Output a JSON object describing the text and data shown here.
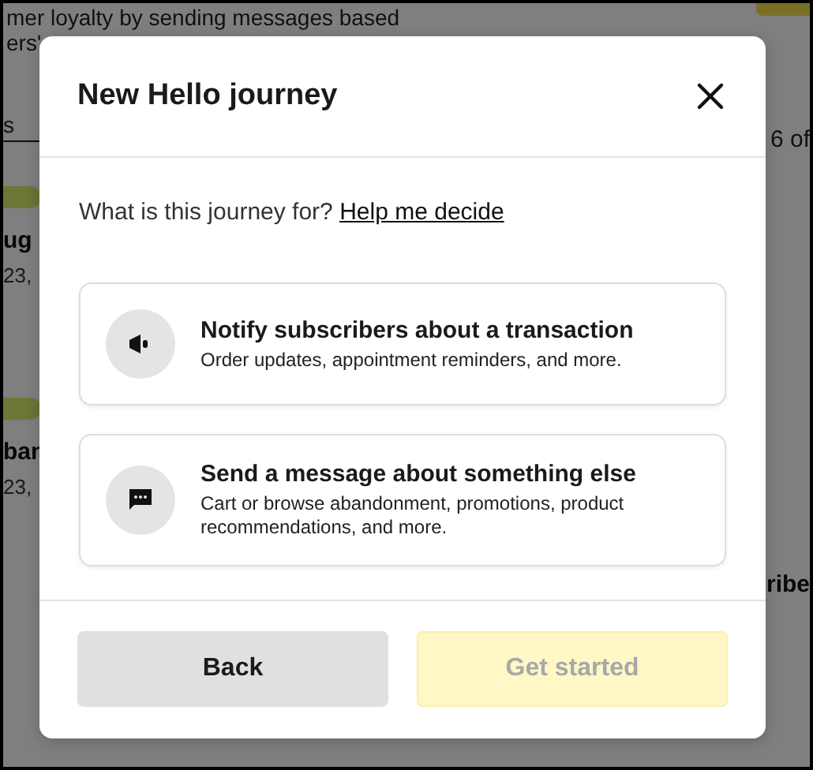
{
  "background": {
    "intro_lines": [
      "mer loyalty by sending messages based",
      "ers'"
    ],
    "left": {
      "tab": "s",
      "cards": [
        {
          "title": "ug",
          "date": "23,"
        },
        {
          "title": "ban",
          "date": "23,"
        }
      ]
    },
    "right": {
      "count": "6 of",
      "card_title": "ribe"
    }
  },
  "dialog": {
    "title": "New Hello journey",
    "question": "What is this journey for?",
    "help_link": "Help me decide",
    "options": [
      {
        "title": "Notify subscribers about a transaction",
        "description": "Order updates, appointment reminders, and more."
      },
      {
        "title": "Send a message about something else",
        "description": "Cart or browse abandonment, promotions, product recommendations, and more."
      }
    ],
    "buttons": [
      {
        "label": "Back",
        "kind": "secondary",
        "disabled": false
      },
      {
        "label": "Get started",
        "kind": "primary",
        "disabled": true
      }
    ]
  }
}
